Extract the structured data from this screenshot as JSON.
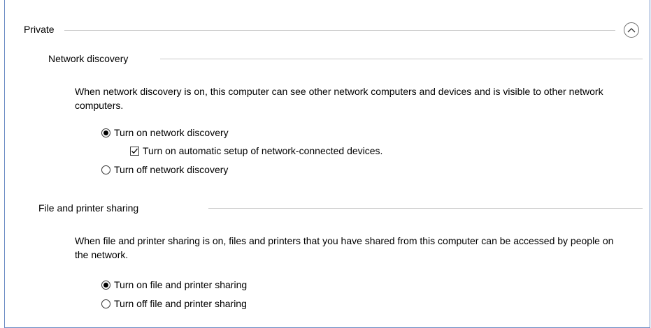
{
  "section": {
    "title": "Private",
    "collapse_icon": "chevron-up-icon"
  },
  "network_discovery": {
    "title": "Network discovery",
    "description": "When network discovery is on, this computer can see other network computers and devices and is visible to other network computers.",
    "options": {
      "turn_on": {
        "label": "Turn on network discovery",
        "checked": true
      },
      "auto_setup": {
        "label": "Turn on automatic setup of network-connected devices.",
        "checked": true
      },
      "turn_off": {
        "label": "Turn off network discovery",
        "checked": false
      }
    }
  },
  "file_printer_sharing": {
    "title": "File and printer sharing",
    "description": "When file and printer sharing is on, files and printers that you have shared from this computer can be accessed by people on the network.",
    "options": {
      "turn_on": {
        "label": "Turn on file and printer sharing",
        "checked": true
      },
      "turn_off": {
        "label": "Turn off file and printer sharing",
        "checked": false
      }
    }
  },
  "colors": {
    "frame_border": "#6b8cc4",
    "divider": "#c7c7c7"
  }
}
